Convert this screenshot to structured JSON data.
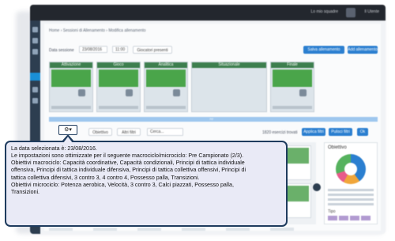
{
  "topbar": {
    "profile_label": "Lo mio squadre",
    "user_label": "Il Utente"
  },
  "breadcrumb": "Home  ›  Sessioni di Allenamento  ›  Modifica allenamento",
  "date_row": {
    "date_label": "Data sessione",
    "date_value": "23/08/2016",
    "time_value": "11:00",
    "present_button": "Giocatori presenti",
    "save_button": "Salva allenamento",
    "add_button": "Add allenamento"
  },
  "phases": [
    "Attivazione",
    "Gioco",
    "Analitica",
    "Situazionale",
    "Finale"
  ],
  "filters": {
    "obiettivo_label": "Obiettivo",
    "altri_label": "Altri filtri",
    "search_placeholder": "Cerca...",
    "results_label": "1820 esercizi trovati",
    "apply_button": "Applica filtri",
    "reset_button": "Pulisci filtri",
    "ok_button": "Ok"
  },
  "right_panel": {
    "title": "Obiettivo",
    "tipo_label": "Tipo"
  },
  "tooltip": {
    "line1": "La data selezionata è: 23/08/2016.",
    "line2": "Le impostazioni sono ottimizzate per il seguente macrociclo/microciclo: Pre Campionato (2/3).",
    "line3": "Obiettivi macrociclo: Capacità coordinative, Capacità condizionali, Principi di tattica individuale",
    "line4": "offensiva, Principi di tattica individuale difensiva, Principi di tattica collettiva offensivi, Principi di",
    "line5": "tattica collettiva difensivi, 3 contro 3, 4 contro 4, Possesso palla, Transizioni.",
    "line6": "Obiettivi microciclo: Potenza aerobica, Velocità, 3 contro 3, Calci piazzati, Possesso palla,",
    "line7": "Transizioni."
  },
  "caret_button": "⚙▾",
  "colors": {
    "tooltip_border": "#1f3c5e",
    "tooltip_bg": "#e9eaf6",
    "accent": "#2b7fd0"
  }
}
